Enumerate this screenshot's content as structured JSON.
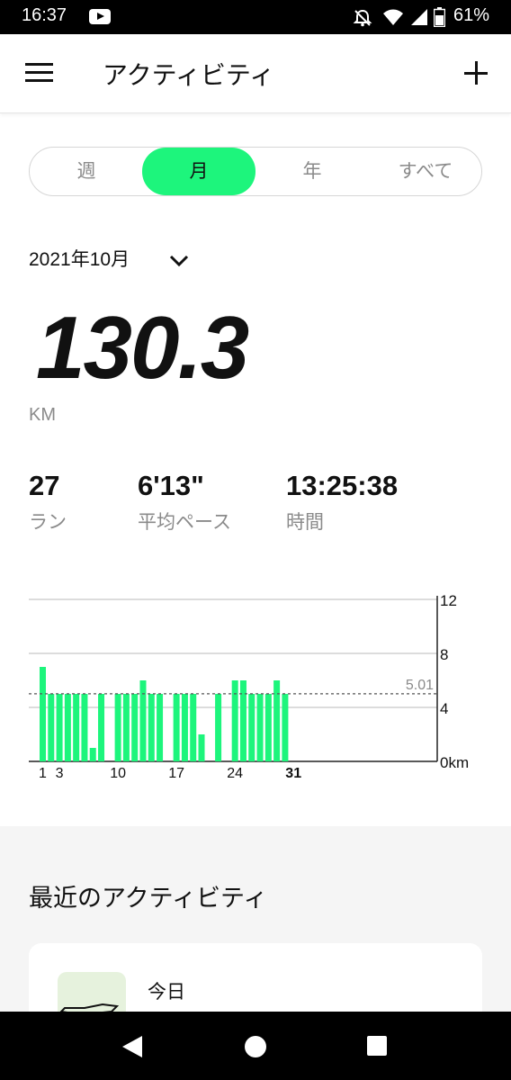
{
  "status_bar": {
    "time": "16:37",
    "battery": "61%"
  },
  "app_bar": {
    "title": "アクティビティ"
  },
  "tabs": [
    {
      "label": "週",
      "active": false
    },
    {
      "label": "月",
      "active": true
    },
    {
      "label": "年",
      "active": false
    },
    {
      "label": "すべて",
      "active": false
    }
  ],
  "period": {
    "label": "2021年10月"
  },
  "summary": {
    "distance": "130.3",
    "unit": "KM",
    "stats": [
      {
        "value": "27",
        "label": "ラン"
      },
      {
        "value": "6'13\"",
        "label": "平均ペース"
      },
      {
        "value": "13:25:38",
        "label": "時間"
      }
    ]
  },
  "colors": {
    "accent": "#1df57c",
    "muted": "#8a8a8a",
    "text": "#111111"
  },
  "chart_data": {
    "type": "bar",
    "x": [
      1,
      2,
      3,
      4,
      5,
      6,
      7,
      8,
      9,
      10,
      11,
      12,
      13,
      14,
      15,
      16,
      17,
      18,
      19,
      20,
      21,
      22,
      23,
      24,
      25,
      26,
      27,
      28,
      29,
      30,
      31
    ],
    "values": [
      7.0,
      5.0,
      5.0,
      5.0,
      5.0,
      5.0,
      1.0,
      5.0,
      0,
      5.0,
      5.0,
      5.0,
      6.0,
      5.0,
      5.0,
      0,
      5.0,
      5.0,
      5.0,
      2.0,
      0,
      5.0,
      0,
      6.0,
      6.0,
      5.0,
      5.0,
      5.0,
      6.0,
      5.0,
      0
    ],
    "x_tick_labels": [
      "1",
      "3",
      "10",
      "17",
      "24",
      "31"
    ],
    "y_ticks": [
      "12",
      "8",
      "4",
      "0km"
    ],
    "ylim": [
      0,
      12
    ],
    "average": {
      "value": 5.01,
      "label": "5.01"
    },
    "highlight_label": "31",
    "bar_color": "#1df57c",
    "grid": true
  },
  "recent": {
    "title": "最近のアクティビティ",
    "items": [
      {
        "date": "今日"
      }
    ]
  }
}
